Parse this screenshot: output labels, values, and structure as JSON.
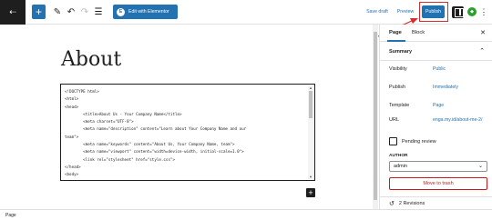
{
  "toolbar": {
    "logo_glyph": "⇠",
    "add_glyph": "+",
    "pen_glyph": "✎",
    "undo_glyph": "↶",
    "redo_glyph": "↷",
    "outline_glyph": "☰",
    "elementor_badge": "E",
    "elementor_label": "Edit with Elementor",
    "save_draft_label": "Save draft",
    "preview_label": "Preview",
    "publish_label": "Publish",
    "plugin_glyph": "◆",
    "more_glyph": "⋮",
    "highlight_color": "#d92c2c",
    "accent_color": "#2271b1"
  },
  "editor": {
    "title": "About",
    "code_lines": [
      "<!DOCTYPE html>",
      "<html>",
      "<head>",
      "        <title>About Us - Your Company Name</title>",
      "        <meta charset=\"UTF-8\">",
      "        <meta name=\"description\" content=\"Learn about Your Company Name and our",
      "team\">",
      "        <meta name=\"keywords\" content=\"About Us, Your Company Name, team\">",
      "        <meta name=\"viewport\" content=\"width=device-width, initial-scale=1.0\">",
      "        <link rel=\"stylesheet\" href=\"style.css\">",
      "</head>",
      "<body>"
    ],
    "inserter_glyph": "+",
    "scroll_up_glyph": "▲",
    "scroll_down_glyph": "▼"
  },
  "sidebar": {
    "tabs": [
      "Page",
      "Block"
    ],
    "close_glyph": "✕",
    "summary_title": "Summary",
    "summary_chevron": "⌃",
    "rows": [
      {
        "label": "Visibility",
        "value": "Public"
      },
      {
        "label": "Publish",
        "value": "Immediately"
      },
      {
        "label": "Template",
        "value": "Page"
      },
      {
        "label": "URL",
        "value": "enga.my.id/about-me-2/"
      }
    ],
    "pending_label": "Pending review",
    "author_label": "AUTHOR",
    "author_value": "admin",
    "select_chevron": "⌄",
    "trash_label": "Move to trash",
    "revisions_glyph": "↺",
    "revisions_label": "2 Revisions"
  },
  "footer": {
    "breadcrumb": "Page"
  }
}
